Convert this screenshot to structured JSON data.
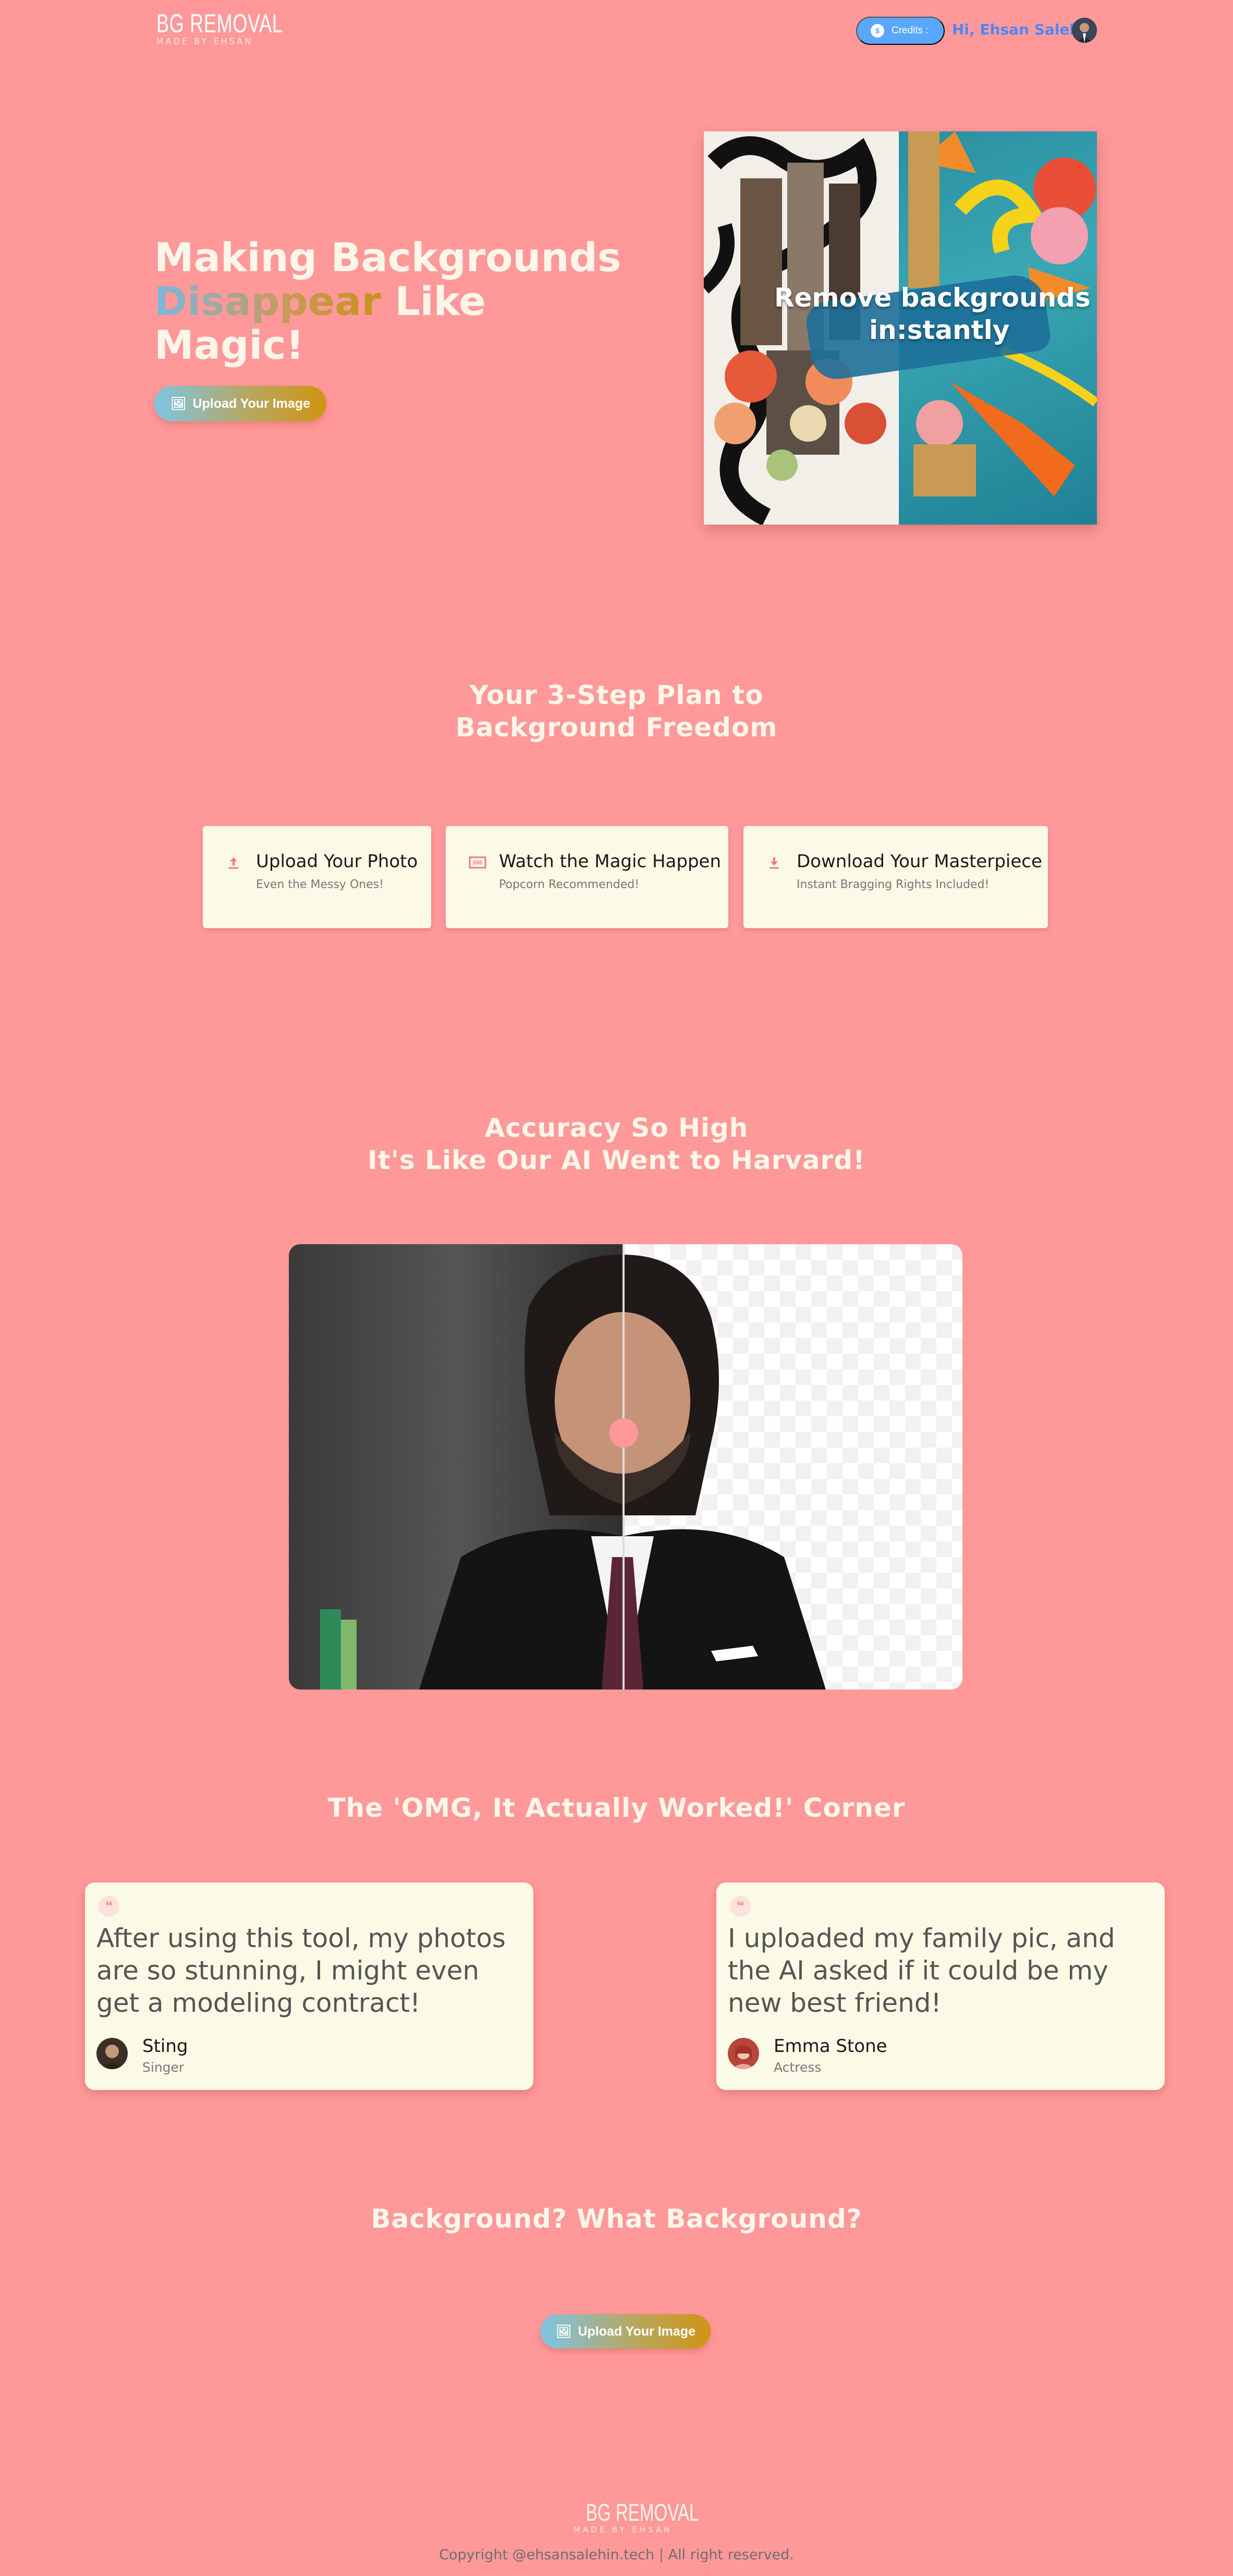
{
  "header": {
    "logo_main": "BG REMOVAL",
    "logo_sub": "MADE BY EHSAN",
    "credits_label": "Credits :",
    "greeting": "Hi, Ehsan Salehin"
  },
  "hero": {
    "title_line1": "Making Backgrounds",
    "title_highlight": "Disappear",
    "title_line2_rest": " Like",
    "title_line3": "Magic!",
    "upload_button": "Upload Your Image",
    "image_text_1": "Remove backgrounds",
    "image_text_2": "in:stantly"
  },
  "steps": {
    "heading_line1": "Your 3-Step Plan to",
    "heading_line2": "Background Freedom",
    "items": [
      {
        "title": "Upload Your Photo",
        "subtitle": "Even the Messy Ones!",
        "icon": "upload-icon"
      },
      {
        "title": "Watch the Magic Happen",
        "subtitle": "Popcorn Recommended!",
        "icon": "screen-icon"
      },
      {
        "title": "Download Your Masterpiece",
        "subtitle": "Instant Bragging Rights Included!",
        "icon": "download-icon"
      }
    ]
  },
  "accuracy": {
    "heading_line1": "Accuracy So High",
    "heading_line2": "It's Like Our AI Went to Harvard!"
  },
  "testimonials": {
    "heading": "The 'OMG, It Actually Worked!' Corner",
    "items": [
      {
        "quote": "After using this tool, my photos are so stunning, I might even get a modeling contract!",
        "name": "Sting",
        "role": "Singer"
      },
      {
        "quote": "I uploaded my family pic, and the AI asked if it could be my new best friend!",
        "name": "Emma Stone",
        "role": "Actress"
      }
    ]
  },
  "cta": {
    "heading": "Background? What Background?",
    "upload_button": "Upload Your Image"
  },
  "footer": {
    "logo_main": "BG REMOVAL",
    "logo_sub": "MADE BY EHSAN",
    "copyright": "Copyright @ehsansalehin.tech | All right reserved."
  }
}
